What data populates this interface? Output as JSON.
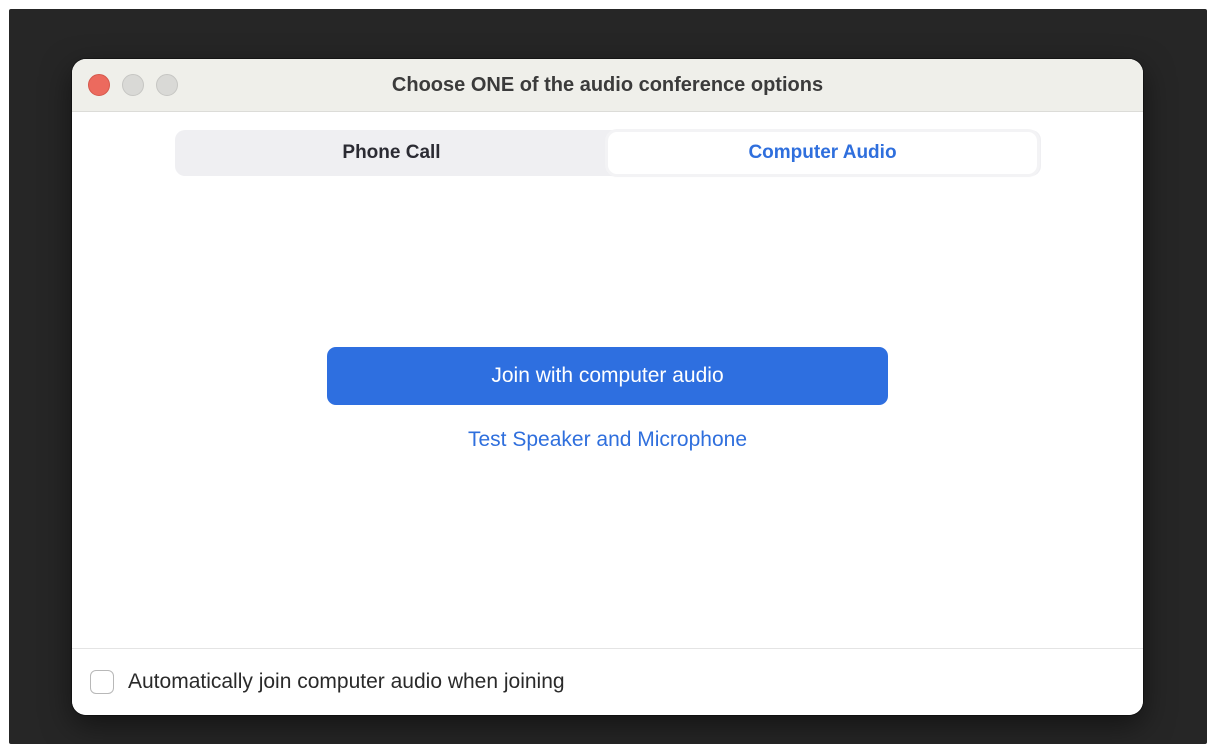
{
  "window": {
    "title": "Choose ONE of the audio conference options"
  },
  "tabs": [
    {
      "label": "Phone Call",
      "selected": false
    },
    {
      "label": "Computer Audio",
      "selected": true
    }
  ],
  "main": {
    "join_button_label": "Join with computer audio",
    "test_link_label": "Test Speaker and Microphone"
  },
  "footer": {
    "auto_join_label": "Automatically join computer audio when joining",
    "auto_join_checked": false
  },
  "colors": {
    "accent": "#2e6fe0",
    "link": "#2f6fdd",
    "close_button": "#ec6a5e",
    "backdrop": "#262626"
  }
}
